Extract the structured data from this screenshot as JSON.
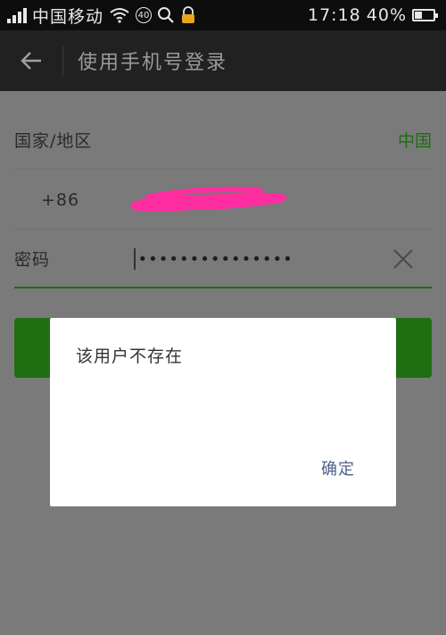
{
  "status_bar": {
    "carrier": "中国移动",
    "network_badge": "40",
    "time": "17:18",
    "battery": "40%",
    "battery_level": 0.4,
    "icons": [
      "signal-icon",
      "wifi-icon",
      "search-icon",
      "lock-icon",
      "battery-icon"
    ]
  },
  "header": {
    "title": "使用手机号登录"
  },
  "form": {
    "country_label": "国家/地区",
    "country_value": "中国",
    "country_code": "+86",
    "password_label": "密码",
    "password_value": "•••••••••••••••"
  },
  "dialog": {
    "message": "该用户不存在",
    "ok_label": "确定"
  },
  "colors": {
    "accent_green": "#1f6e12",
    "overlay_gray": "#7a7a7a",
    "header_bg": "#212121",
    "dialog_ok": "#4c5f8a"
  }
}
